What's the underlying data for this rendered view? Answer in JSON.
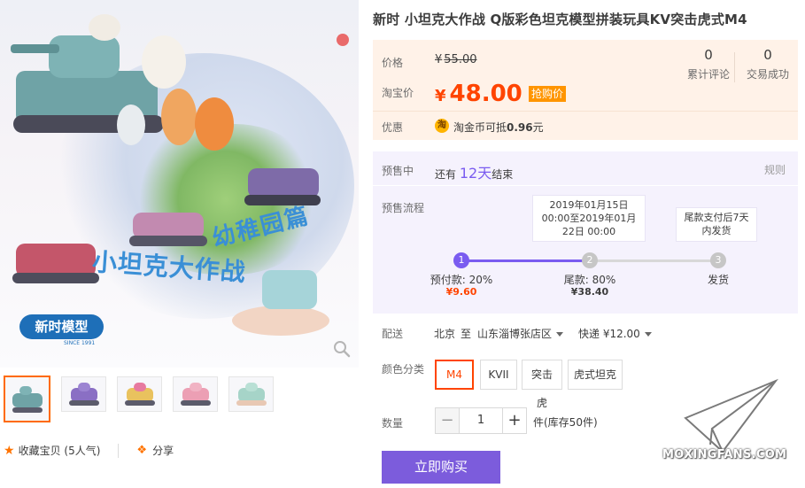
{
  "product": {
    "title": "新时 小坦克大作战 Q版彩色坦克模型拼装玩具KV突击虎式M4"
  },
  "gallery": {
    "artwork_title": "小坦克大作战",
    "artwork_tagline": "幼稚园篇",
    "brand_logo_text": "新时模型",
    "brand_logo_sub": "SINCE 1991",
    "thumbnails": [
      "main",
      "purple-tank",
      "yellow-pink-tank",
      "pink-tank",
      "mint-tank"
    ]
  },
  "actions": {
    "favorite_label": "收藏宝贝",
    "favorite_count": "(5人气)",
    "share_label": "分享"
  },
  "price": {
    "original_label": "价格",
    "original_currency": "¥",
    "original_value": "55.00",
    "taobao_label": "淘宝价",
    "currency": "¥",
    "value": "48.00",
    "rush_tag": "抢购价",
    "reviews_count": "0",
    "reviews_label": "累计评论",
    "deals_count": "0",
    "deals_label": "交易成功",
    "promo_label": "优惠",
    "promo_icon": "淘",
    "promo_text": "淘金币可抵",
    "promo_amount": "0.96",
    "promo_unit": "元"
  },
  "presale": {
    "label": "预售中",
    "remain_prefix": "还有",
    "remain_days": "12天",
    "remain_suffix": "结束",
    "rules_link": "规则",
    "flow_label": "预售流程",
    "step1_card": "2019年01月15日 00:00至2019年01月22日 00:00",
    "step1_card_line1": "2019年01月15日",
    "step1_card_line2": "00:00至2019年01月",
    "step1_card_line3": "22日 00:00",
    "step2_card_line1": "尾款支付后7天",
    "step2_card_line2": "内发货",
    "progress_fraction": 0.5,
    "steps": [
      {
        "num": "1",
        "label": "预付款: 20%",
        "amount": "¥9.60",
        "active": true
      },
      {
        "num": "2",
        "label": "尾款: 80%",
        "amount": "¥38.40",
        "active": false
      },
      {
        "num": "3",
        "label": "发货",
        "amount": "",
        "active": false
      }
    ],
    "accent_color": "#7a5cf0"
  },
  "delivery": {
    "label": "配送",
    "from": "北京",
    "to_word": "至",
    "to": "山东淄博张店区",
    "express": "快递 ¥12.00"
  },
  "color": {
    "label": "颜色分类",
    "options": [
      "M4",
      "KVII",
      "突击虎",
      "虎式坦克"
    ],
    "selected": "M4"
  },
  "quantity": {
    "label": "数量",
    "minus": "−",
    "value": "1",
    "plus": "+",
    "stock_text": "件(库存50件)"
  },
  "buy_button": "立即购买",
  "watermark": "MOXINGFANS.COM",
  "colors": {
    "price_red": "#ff4400",
    "price_bg": "#fff2e8",
    "presale_bg": "#f5f2fd",
    "buy_purple": "#7c5cdc",
    "tag_orange": "#ff9500"
  }
}
